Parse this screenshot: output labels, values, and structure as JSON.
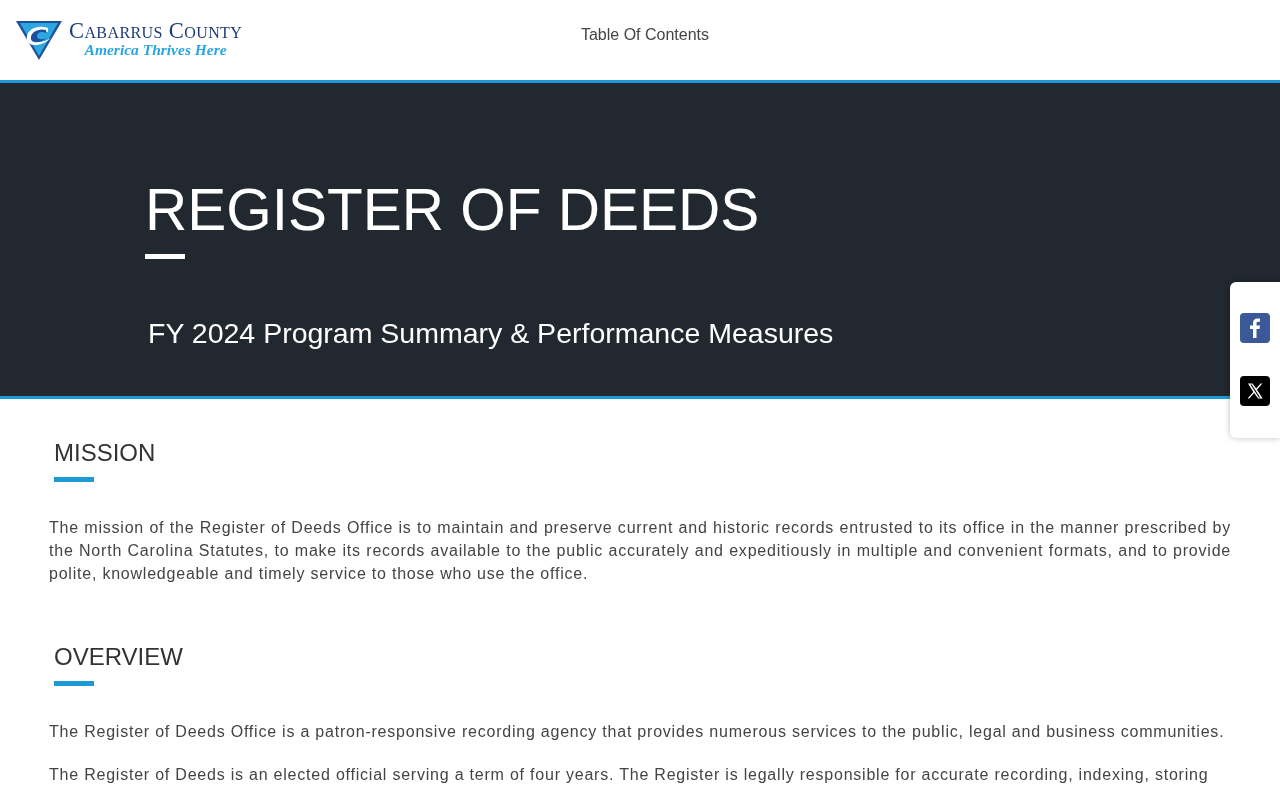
{
  "header": {
    "logo": {
      "name": "Cabarrus County",
      "tagline": "America Thrives Here"
    },
    "nav": [
      {
        "label": "Table Of Contents"
      }
    ]
  },
  "banner": {
    "title": "REGISTER OF DEEDS",
    "subtitle": "FY 2024 Program Summary & Performance Measures"
  },
  "share": [
    {
      "kind": "facebook"
    },
    {
      "kind": "x"
    }
  ],
  "sections": [
    {
      "heading": "MISSION",
      "paragraphs": [
        "The mission of the Register of Deeds Office is to maintain and preserve current and historic records entrusted to its office in the manner prescribed by the North Carolina Statutes, to make its records available to the public accurately and expeditiously in multiple and convenient formats, and to provide polite, knowledgeable and timely service to those who use the office."
      ]
    },
    {
      "heading": "OVERVIEW",
      "paragraphs": [
        "The Register of Deeds Office is a patron-responsive recording agency that provides numerous services to the public, legal and business communities.",
        "The Register of Deeds is an elected official serving a term of four years. The Register is legally responsible for accurate recording, indexing, storing"
      ]
    }
  ]
}
